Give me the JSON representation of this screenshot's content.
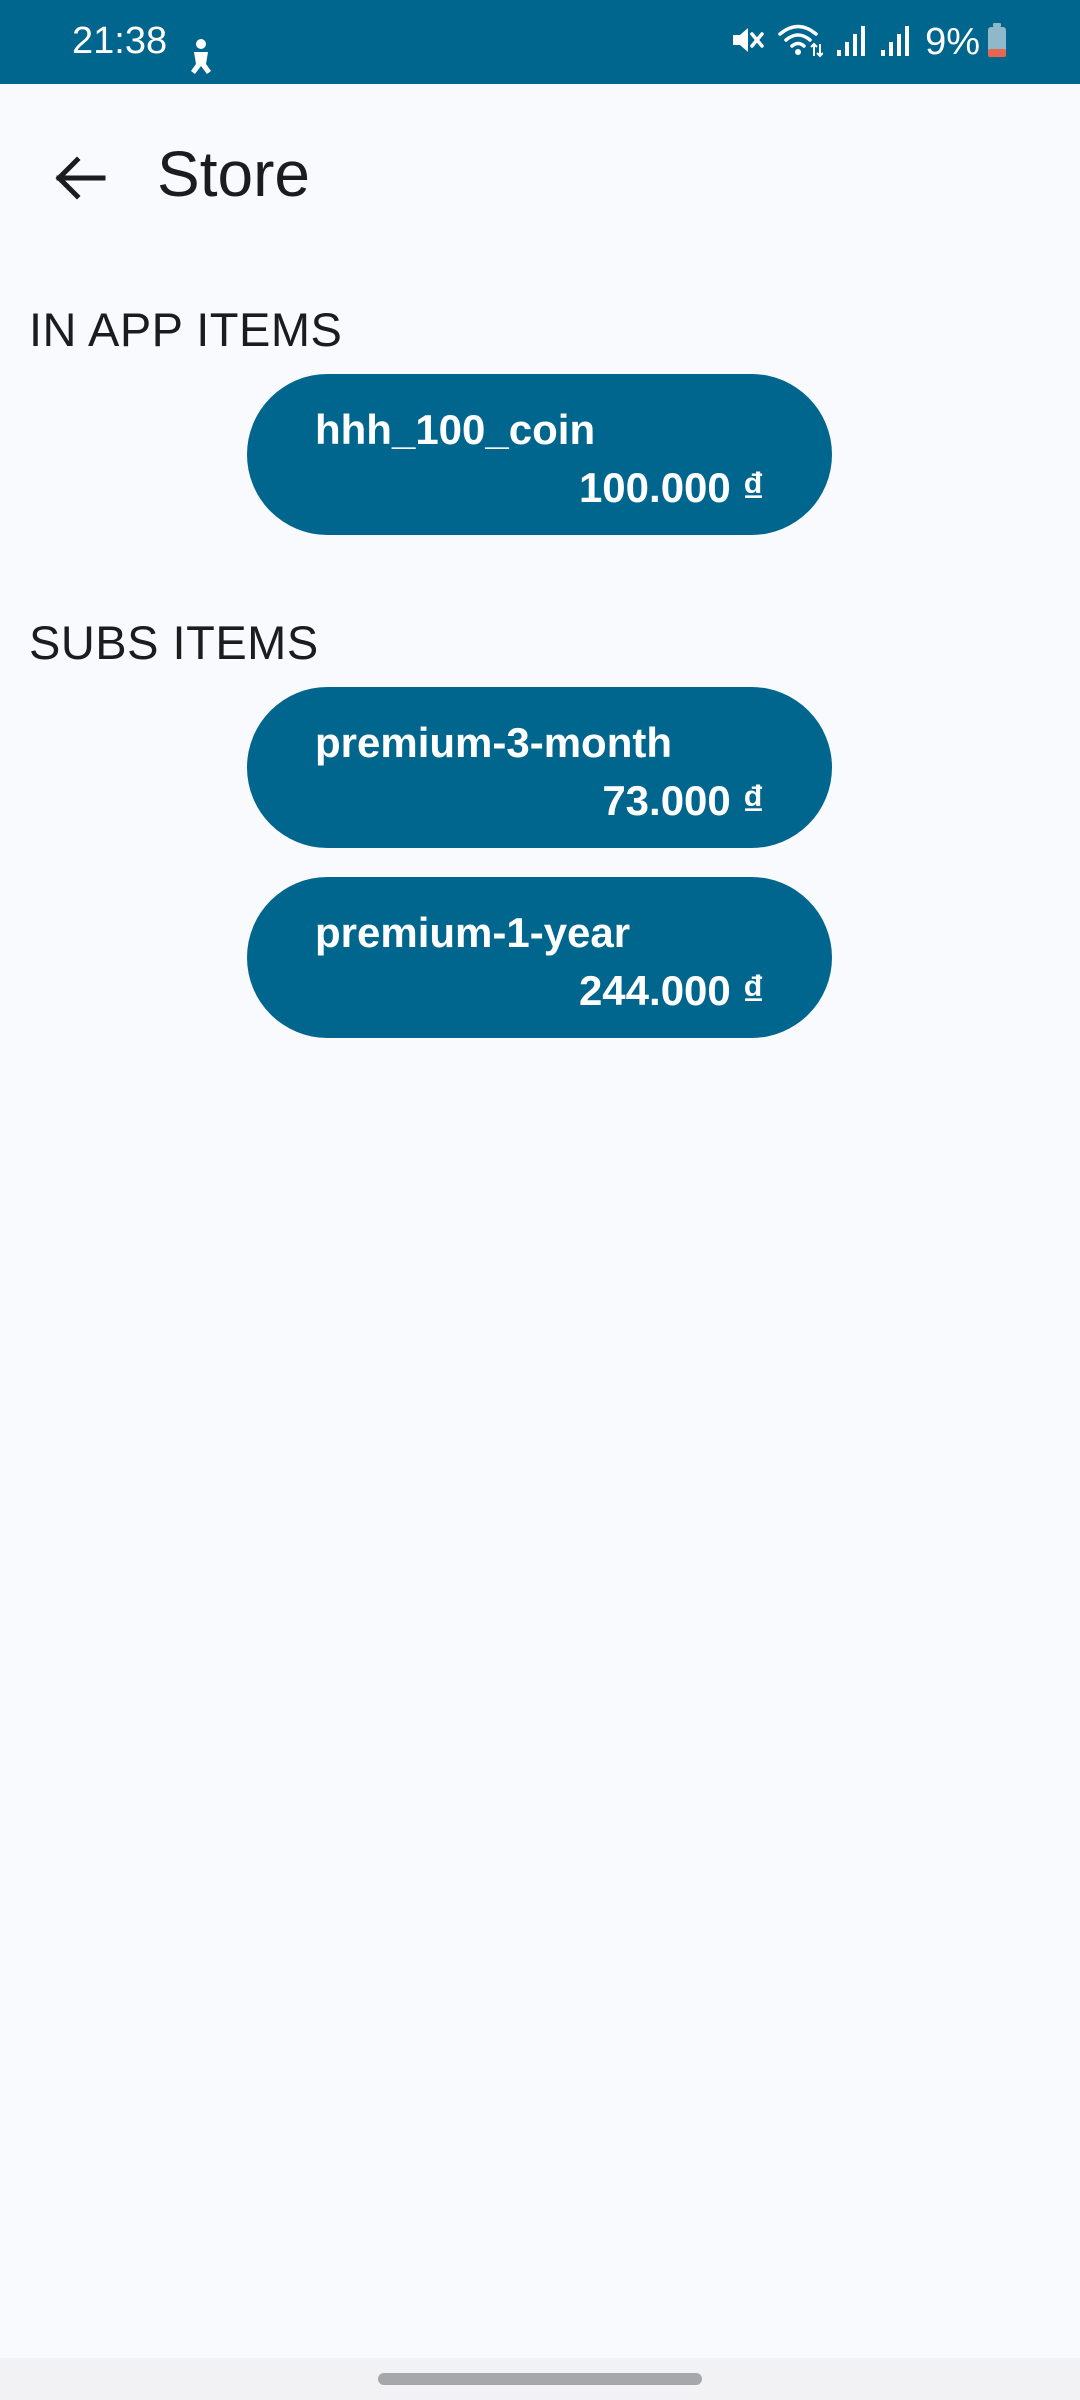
{
  "status_bar": {
    "time": "21:38",
    "battery": "9%",
    "icons": [
      "person-icon",
      "mute-icon",
      "wifi-icon",
      "signal-icon",
      "signal-icon",
      "battery-icon"
    ]
  },
  "app_bar": {
    "title": "Store",
    "back_icon": "arrow-back-icon"
  },
  "sections": {
    "in_app": {
      "header": "IN APP ITEMS",
      "items": [
        {
          "name": "hhh_100_coin",
          "price": "100.000 ₫"
        }
      ]
    },
    "subs": {
      "header": "SUBS ITEMS",
      "items": [
        {
          "name": "premium-3-month",
          "price": "73.000 ₫"
        },
        {
          "name": "premium-1-year",
          "price": "244.000 ₫"
        }
      ]
    }
  },
  "colors": {
    "primary": "#01668e",
    "background": "#f9fafd",
    "text": "#1b1c1e",
    "on_primary": "#ffffff"
  }
}
